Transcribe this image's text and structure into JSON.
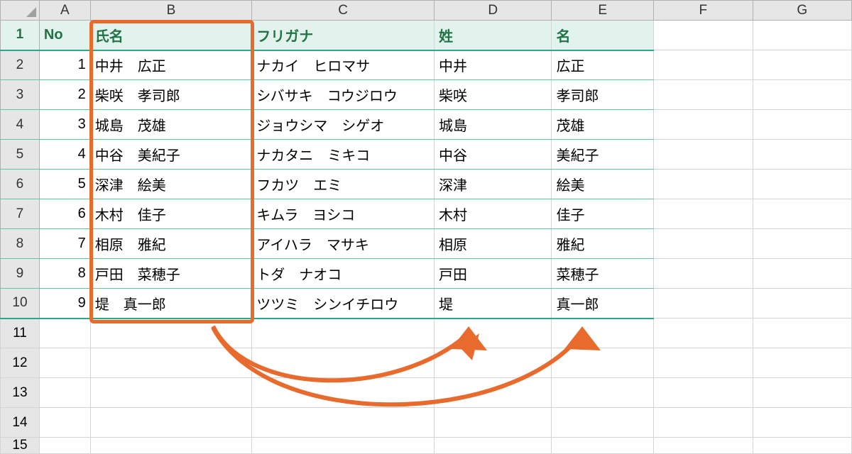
{
  "columns": [
    "A",
    "B",
    "C",
    "D",
    "E",
    "F",
    "G"
  ],
  "rowNumbers": [
    "1",
    "2",
    "3",
    "4",
    "5",
    "6",
    "7",
    "8",
    "9",
    "10",
    "11",
    "12",
    "13",
    "14",
    "15"
  ],
  "header": {
    "no": "No",
    "name": "氏名",
    "furigana": "フリガナ",
    "sei": "姓",
    "mei": "名"
  },
  "rows": [
    {
      "no": "1",
      "name": "中井　広正",
      "furigana": "ナカイ　ヒロマサ",
      "sei": "中井",
      "mei": "広正"
    },
    {
      "no": "2",
      "name": "柴咲　孝司郎",
      "furigana": "シバサキ　コウジロウ",
      "sei": "柴咲",
      "mei": "孝司郎"
    },
    {
      "no": "3",
      "name": "城島　茂雄",
      "furigana": "ジョウシマ　シゲオ",
      "sei": "城島",
      "mei": "茂雄"
    },
    {
      "no": "4",
      "name": "中谷　美紀子",
      "furigana": "ナカタニ　ミキコ",
      "sei": "中谷",
      "mei": "美紀子"
    },
    {
      "no": "5",
      "name": "深津　絵美",
      "furigana": "フカツ　エミ",
      "sei": "深津",
      "mei": "絵美"
    },
    {
      "no": "6",
      "name": "木村　佳子",
      "furigana": "キムラ　ヨシコ",
      "sei": "木村",
      "mei": "佳子"
    },
    {
      "no": "7",
      "name": "相原　雅紀",
      "furigana": "アイハラ　マサキ",
      "sei": "相原",
      "mei": "雅紀"
    },
    {
      "no": "8",
      "name": "戸田　菜穂子",
      "furigana": "トダ　ナオコ",
      "sei": "戸田",
      "mei": "菜穂子"
    },
    {
      "no": "9",
      "name": "堤　真一郎",
      "furigana": "ツツミ　シンイチロウ",
      "sei": "堤",
      "mei": "真一郎"
    }
  ],
  "annotation": {
    "highlight_column": "B",
    "arrow_targets": [
      "D",
      "E"
    ]
  }
}
